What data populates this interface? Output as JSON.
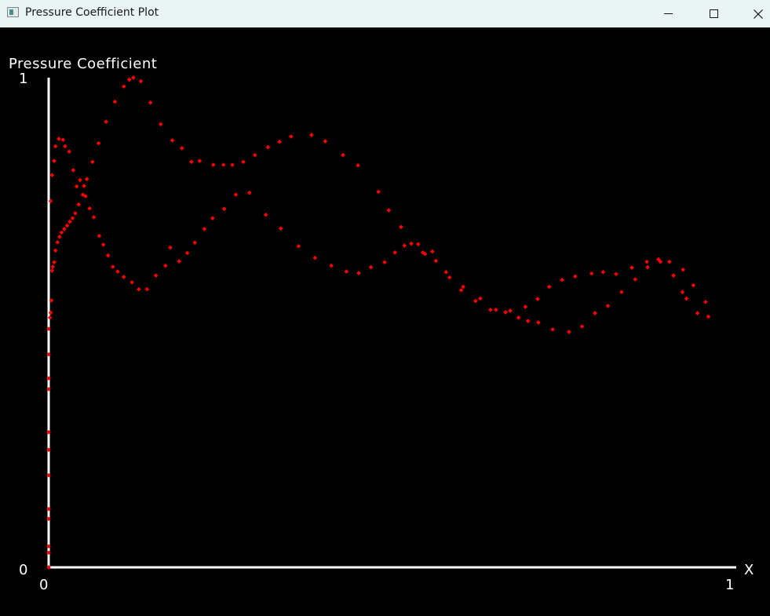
{
  "window": {
    "title": "Pressure Coefficient Plot"
  },
  "chart_data": {
    "type": "scatter",
    "title": "Pressure Coefficient",
    "xlabel": "X",
    "ylabel": "",
    "x_ticks": [
      "0",
      "1"
    ],
    "y_ticks": [
      "0",
      "1"
    ],
    "xlim": [
      0,
      1
    ],
    "ylim": [
      0,
      1
    ],
    "grid": false,
    "marker_color": "#ff0000",
    "axis_color": "#ffffff",
    "background": "#000000",
    "series": [
      {
        "values": [
          [
            0.0,
            0.0
          ],
          [
            0.0,
            0.03
          ],
          [
            0.0,
            0.043
          ],
          [
            0.0,
            0.099
          ],
          [
            0.0,
            0.119
          ],
          [
            0.0,
            0.188
          ],
          [
            0.0,
            0.24
          ],
          [
            0.0,
            0.276
          ],
          [
            0.0,
            0.364
          ],
          [
            0.0,
            0.386
          ],
          [
            0.0,
            0.435
          ],
          [
            0.0,
            0.487
          ],
          [
            0.002,
            0.51
          ],
          [
            0.003,
            0.52
          ],
          [
            0.004,
            0.545
          ],
          [
            0.005,
            0.606
          ],
          [
            0.006,
            0.614
          ],
          [
            0.008,
            0.623
          ],
          [
            0.01,
            0.647
          ],
          [
            0.013,
            0.664
          ],
          [
            0.016,
            0.675
          ],
          [
            0.019,
            0.684
          ],
          [
            0.023,
            0.691
          ],
          [
            0.027,
            0.698
          ],
          [
            0.031,
            0.706
          ],
          [
            0.035,
            0.713
          ],
          [
            0.039,
            0.723
          ],
          [
            0.044,
            0.741
          ],
          [
            0.05,
            0.761
          ],
          [
            0.056,
            0.793
          ],
          [
            0.064,
            0.828
          ],
          [
            0.073,
            0.866
          ],
          [
            0.084,
            0.91
          ],
          [
            0.097,
            0.951
          ],
          [
            0.11,
            0.982
          ],
          [
            0.118,
            0.996
          ],
          [
            0.124,
            1.0
          ],
          [
            0.135,
            0.993
          ],
          [
            0.149,
            0.949
          ],
          [
            0.164,
            0.905
          ],
          [
            0.181,
            0.872
          ],
          [
            0.195,
            0.856
          ],
          [
            0.209,
            0.828
          ],
          [
            0.221,
            0.83
          ],
          [
            0.241,
            0.822
          ],
          [
            0.256,
            0.822
          ],
          [
            0.269,
            0.822
          ],
          [
            0.285,
            0.828
          ],
          [
            0.302,
            0.842
          ],
          [
            0.321,
            0.858
          ],
          [
            0.338,
            0.869
          ],
          [
            0.355,
            0.88
          ],
          [
            0.385,
            0.883
          ],
          [
            0.405,
            0.87
          ],
          [
            0.431,
            0.842
          ],
          [
            0.453,
            0.821
          ],
          [
            0.483,
            0.767
          ],
          [
            0.498,
            0.729
          ],
          [
            0.516,
            0.695
          ],
          [
            0.531,
            0.661
          ],
          [
            0.548,
            0.643
          ],
          [
            0.567,
            0.626
          ],
          [
            0.587,
            0.592
          ],
          [
            0.604,
            0.566
          ],
          [
            0.625,
            0.544
          ],
          [
            0.647,
            0.526
          ],
          [
            0.669,
            0.521
          ],
          [
            0.688,
            0.51
          ],
          [
            0.702,
            0.503
          ],
          [
            0.717,
            0.5
          ],
          [
            0.738,
            0.486
          ],
          [
            0.762,
            0.481
          ],
          [
            0.781,
            0.492
          ],
          [
            0.8,
            0.519
          ],
          [
            0.819,
            0.534
          ],
          [
            0.839,
            0.562
          ],
          [
            0.859,
            0.588
          ],
          [
            0.877,
            0.613
          ],
          [
            0.896,
            0.624
          ],
          [
            0.915,
            0.596
          ],
          [
            0.928,
            0.562
          ],
          [
            0.934,
            0.549
          ],
          [
            0.95,
            0.519
          ],
          [
            0.966,
            0.512
          ]
        ]
      },
      {
        "values": [
          [
            0.003,
            0.748
          ],
          [
            0.005,
            0.801
          ],
          [
            0.008,
            0.83
          ],
          [
            0.01,
            0.86
          ],
          [
            0.015,
            0.875
          ],
          [
            0.021,
            0.873
          ],
          [
            0.024,
            0.86
          ],
          [
            0.03,
            0.849
          ],
          [
            0.036,
            0.811
          ],
          [
            0.041,
            0.778
          ],
          [
            0.046,
            0.791
          ],
          [
            0.052,
            0.779
          ],
          [
            0.054,
            0.758
          ],
          [
            0.06,
            0.733
          ],
          [
            0.066,
            0.715
          ],
          [
            0.074,
            0.677
          ],
          [
            0.08,
            0.659
          ],
          [
            0.087,
            0.637
          ],
          [
            0.094,
            0.614
          ],
          [
            0.101,
            0.604
          ],
          [
            0.11,
            0.593
          ],
          [
            0.122,
            0.582
          ],
          [
            0.132,
            0.568
          ],
          [
            0.144,
            0.568
          ],
          [
            0.157,
            0.596
          ],
          [
            0.171,
            0.616
          ],
          [
            0.178,
            0.653
          ],
          [
            0.191,
            0.625
          ],
          [
            0.203,
            0.642
          ],
          [
            0.214,
            0.663
          ],
          [
            0.228,
            0.691
          ],
          [
            0.24,
            0.713
          ],
          [
            0.257,
            0.732
          ],
          [
            0.274,
            0.761
          ],
          [
            0.294,
            0.765
          ],
          [
            0.318,
            0.72
          ],
          [
            0.34,
            0.692
          ],
          [
            0.366,
            0.656
          ],
          [
            0.39,
            0.632
          ],
          [
            0.414,
            0.616
          ],
          [
            0.436,
            0.604
          ],
          [
            0.454,
            0.601
          ],
          [
            0.472,
            0.613
          ],
          [
            0.492,
            0.623
          ],
          [
            0.507,
            0.643
          ],
          [
            0.521,
            0.657
          ],
          [
            0.541,
            0.66
          ],
          [
            0.551,
            0.64
          ],
          [
            0.562,
            0.645
          ],
          [
            0.582,
            0.603
          ],
          [
            0.607,
            0.573
          ],
          [
            0.632,
            0.549
          ],
          [
            0.655,
            0.526
          ],
          [
            0.676,
            0.524
          ],
          [
            0.698,
            0.532
          ],
          [
            0.716,
            0.548
          ],
          [
            0.733,
            0.573
          ],
          [
            0.752,
            0.587
          ],
          [
            0.771,
            0.594
          ],
          [
            0.795,
            0.6
          ],
          [
            0.812,
            0.603
          ],
          [
            0.831,
            0.599
          ],
          [
            0.854,
            0.612
          ],
          [
            0.876,
            0.624
          ],
          [
            0.893,
            0.629
          ],
          [
            0.909,
            0.624
          ],
          [
            0.929,
            0.608
          ],
          [
            0.944,
            0.576
          ],
          [
            0.962,
            0.542
          ]
        ]
      }
    ]
  }
}
